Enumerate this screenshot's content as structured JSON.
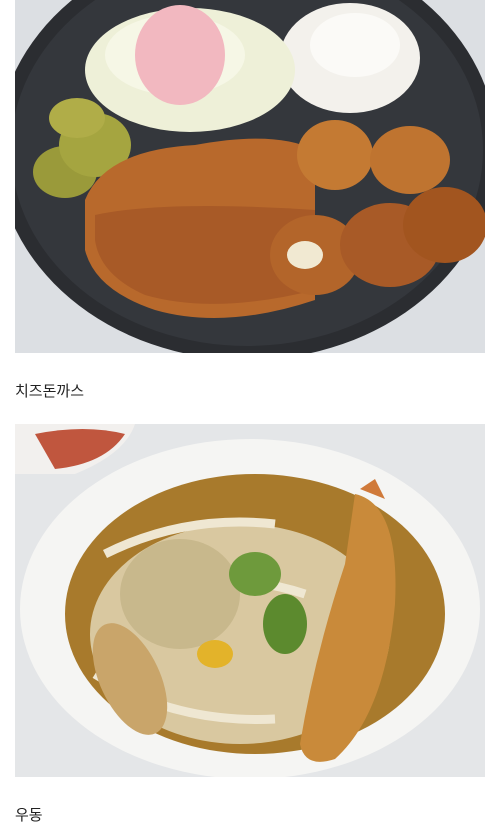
{
  "items": [
    {
      "caption": "치즈돈까스",
      "image": "cheese-tonkatsu-photo",
      "colors": {
        "plate": "#2b2d31",
        "cutlet": "#b8692c",
        "sauce": "#a85a27",
        "rice": "#f3f1ec",
        "cabbage": "#eef0d8"
      }
    },
    {
      "caption": "우동",
      "image": "udon-photo",
      "colors": {
        "bowl": "#f5f5f3",
        "broth": "#a87a2c",
        "noodle": "#efe7d2",
        "shrimp": "#c98a3a",
        "greens": "#5c8a2e"
      }
    }
  ]
}
